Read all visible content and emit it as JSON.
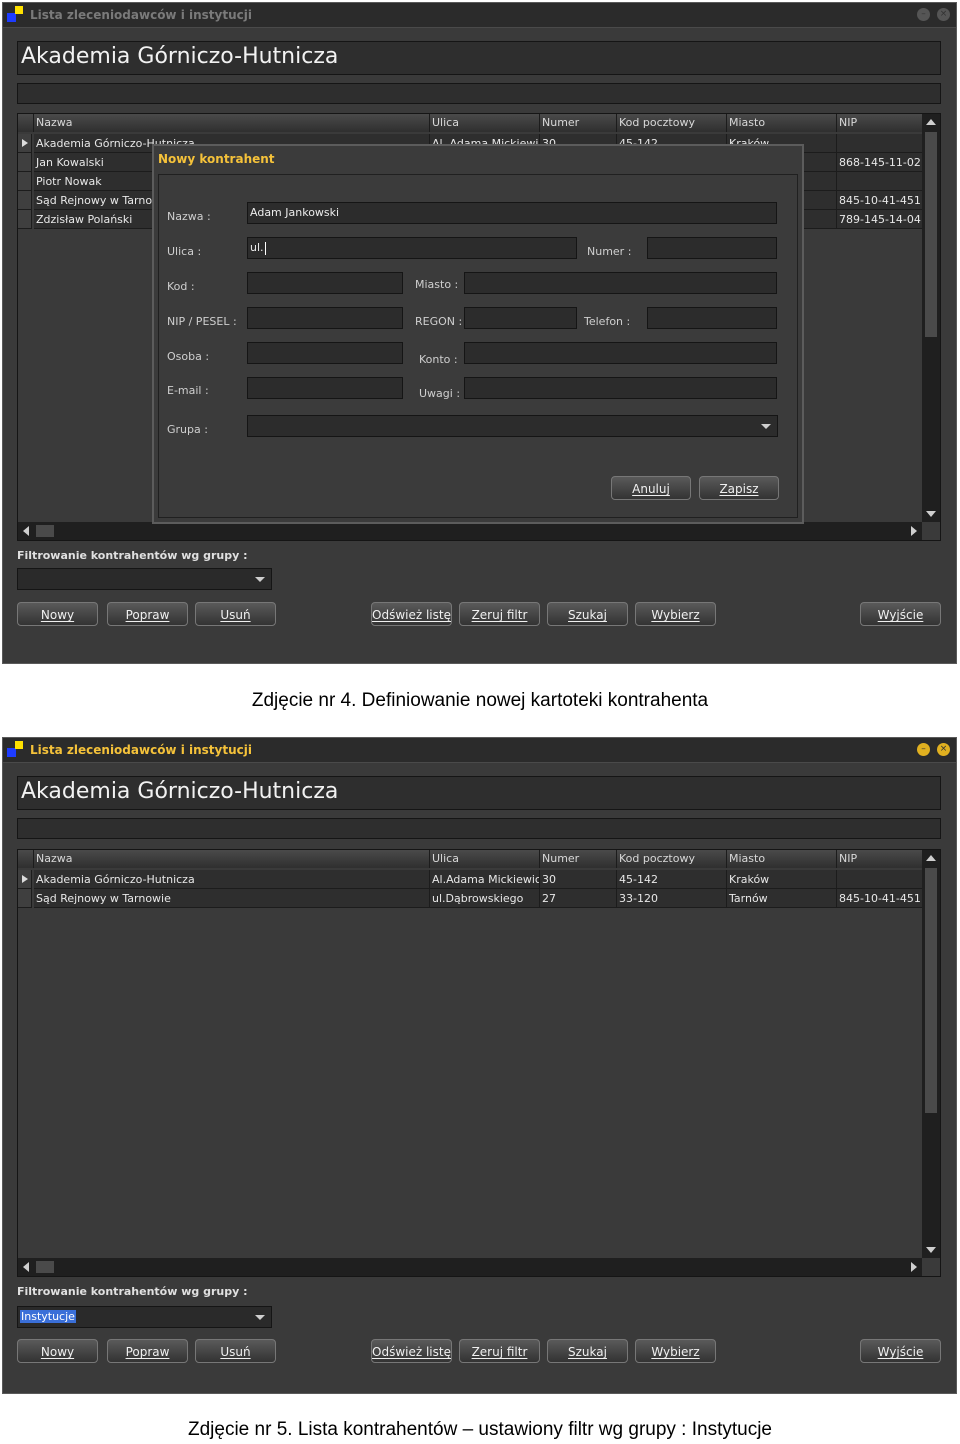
{
  "screen1": {
    "window_title": "Lista zleceniodawców i instytucji",
    "header": "Akademia Górniczo-Hutnicza",
    "columns": [
      "Nazwa",
      "Ulica",
      "Numer",
      "Kod pocztowy",
      "Miasto",
      "NIP"
    ],
    "rows": [
      {
        "nazwa": "Akademia Górniczo-Hutnicza",
        "ulica": "Al. Adama Mickiewicz",
        "numer": "30",
        "kod": "45-142",
        "miasto": "Kraków",
        "nip": ""
      },
      {
        "nazwa": "Jan Kowalski",
        "ulica": "",
        "numer": "",
        "kod": "",
        "miasto": "",
        "nip": "868-145-11-02"
      },
      {
        "nazwa": "Piotr Nowak",
        "ulica": "",
        "numer": "",
        "kod": "",
        "miasto": "",
        "nip": ""
      },
      {
        "nazwa": "Sąd Rejnowy w Tarnowie",
        "ulica": "",
        "numer": "",
        "kod": "",
        "miasto": "",
        "nip": "845-10-41-451"
      },
      {
        "nazwa": "Zdzisław Polański",
        "ulica": "",
        "numer": "",
        "kod": "",
        "miasto": "",
        "nip": "789-145-14-04"
      }
    ],
    "filter_label": "Filtrowanie kontrahentów wg grupy :",
    "filter_value": "",
    "buttons": {
      "nowy": "Nowy",
      "popraw": "Popraw",
      "usun": "Usuń",
      "odswiez": "Odśwież listę",
      "zeruj": "Zeruj filtr",
      "szukaj": "Szukaj",
      "wybierz": "Wybierz",
      "wyjscie": "Wyjście"
    },
    "dialog": {
      "title": "Nowy kontrahent",
      "labels": {
        "nazwa": "Nazwa :",
        "ulica": "Ulica :",
        "numer": "Numer :",
        "kod": "Kod :",
        "miasto": "Miasto :",
        "nip": "NIP / PESEL :",
        "regon": "REGON :",
        "telefon": "Telefon :",
        "osoba": "Osoba :",
        "konto": "Konto :",
        "email": "E-mail :",
        "uwagi": "Uwagi :",
        "grupa": "Grupa :"
      },
      "values": {
        "nazwa": "Adam Jankowski",
        "ulica": "ul."
      },
      "buttons": {
        "anuluj": "Anuluj",
        "zapisz": "Zapisz"
      }
    }
  },
  "caption1": "Zdjęcie nr 4. Definiowanie nowej kartoteki kontrahenta",
  "screen2": {
    "window_title": "Lista zleceniodawców i instytucji",
    "header": "Akademia Górniczo-Hutnicza",
    "columns": [
      "Nazwa",
      "Ulica",
      "Numer",
      "Kod pocztowy",
      "Miasto",
      "NIP"
    ],
    "rows": [
      {
        "nazwa": "Akademia Górniczo-Hutnicza",
        "ulica": "Al.Adama Mickiewicz",
        "numer": "30",
        "kod": "45-142",
        "miasto": "Kraków",
        "nip": ""
      },
      {
        "nazwa": "Sąd Rejnowy w Tarnowie",
        "ulica": "ul.Dąbrowskiego",
        "numer": "27",
        "kod": "33-120",
        "miasto": "Tarnów",
        "nip": "845-10-41-451"
      }
    ],
    "filter_label": "Filtrowanie kontrahentów wg grupy :",
    "filter_value": "Instytucje",
    "buttons": {
      "nowy": "Nowy",
      "popraw": "Popraw",
      "usun": "Usuń",
      "odswiez": "Odśwież listę",
      "zeruj": "Zeruj filtr",
      "szukaj": "Szukaj",
      "wybierz": "Wybierz",
      "wyjscie": "Wyjście"
    }
  },
  "caption2": "Zdjęcie nr 5. Lista kontrahentów – ustawiony filtr wg grupy : Instytucje",
  "colors": {
    "dialog_title": "#f5c23a",
    "app_bg": "#3a3a3a",
    "selection": "#3a6fd8"
  }
}
